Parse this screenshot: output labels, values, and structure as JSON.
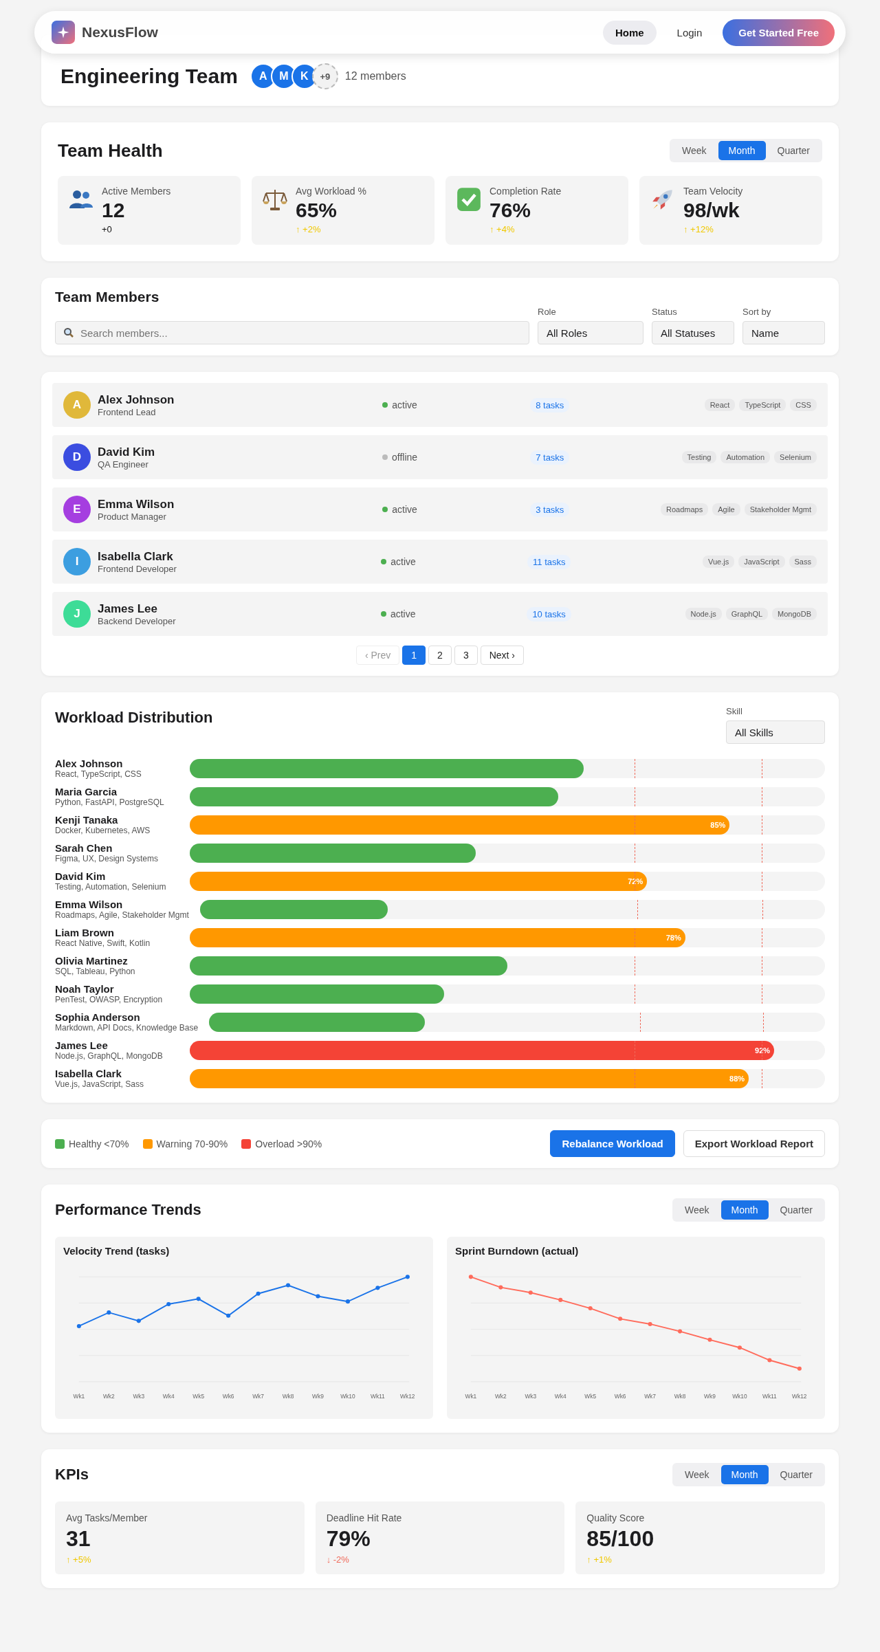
{
  "nav": {
    "brand": "NexusFlow",
    "links": [
      {
        "label": "Home",
        "selected": true
      },
      {
        "label": "Login",
        "selected": false
      }
    ],
    "cta": "Get Started Free"
  },
  "header": {
    "title": "Engineering Team",
    "avatars": [
      {
        "initial": "A",
        "color": "#1a73e8"
      },
      {
        "initial": "M",
        "color": "#1a73e8"
      },
      {
        "initial": "K",
        "color": "#1a73e8"
      }
    ],
    "more": "+9",
    "members": "12 members"
  },
  "team_health": {
    "title": "Team Health",
    "periods": [
      {
        "label": "Week",
        "selected": false
      },
      {
        "label": "Month",
        "selected": true
      },
      {
        "label": "Quarter",
        "selected": false
      }
    ],
    "stats": [
      {
        "kind": "people",
        "label": "Active Members",
        "value": "12",
        "change": "+0",
        "color": "#111111"
      },
      {
        "kind": "scale",
        "label": "Avg Workload %",
        "value": "65%",
        "change": "↑ +2%",
        "color": "#f0c800"
      },
      {
        "kind": "check",
        "label": "Completion Rate",
        "value": "76%",
        "change": "↑ +4%",
        "color": "#f0c800"
      },
      {
        "kind": "rocket",
        "label": "Team Velocity",
        "value": "98/wk",
        "change": "↑ +12%",
        "color": "#f0c800"
      }
    ]
  },
  "members_filter": {
    "title": "Team Members",
    "search": {
      "placeholder": "Search members..."
    },
    "filters": [
      {
        "label": "Role",
        "value": "All Roles"
      },
      {
        "label": "Status",
        "value": "All Statuses"
      },
      {
        "label": "Sort by",
        "value": "Name"
      }
    ]
  },
  "members": [
    {
      "initial": "A",
      "color": "#e0b83a",
      "name": "Alex Johnson",
      "role": "Frontend Lead",
      "status": "active",
      "online": true,
      "tasks": "8 tasks",
      "skills": [
        "React",
        "TypeScript",
        "CSS"
      ]
    },
    {
      "initial": "D",
      "color": "#3b4de0",
      "name": "David Kim",
      "role": "QA Engineer",
      "status": "offline",
      "online": false,
      "tasks": "7 tasks",
      "skills": [
        "Testing",
        "Automation",
        "Selenium"
      ]
    },
    {
      "initial": "E",
      "color": "#a53ee0",
      "name": "Emma Wilson",
      "role": "Product Manager",
      "status": "active",
      "online": true,
      "tasks": "3 tasks",
      "skills": [
        "Roadmaps",
        "Agile",
        "Stakeholder Mgmt"
      ]
    },
    {
      "initial": "I",
      "color": "#3c9ee0",
      "name": "Isabella Clark",
      "role": "Frontend Developer",
      "status": "active",
      "online": true,
      "tasks": "11 tasks",
      "skills": [
        "Vue.js",
        "JavaScript",
        "Sass"
      ]
    },
    {
      "initial": "J",
      "color": "#3ddc97",
      "name": "James Lee",
      "role": "Backend Developer",
      "status": "active",
      "online": true,
      "tasks": "10 tasks",
      "skills": [
        "Node.js",
        "GraphQL",
        "MongoDB"
      ]
    }
  ],
  "pagination": [
    {
      "label": "‹ Prev",
      "selected": false,
      "disabled": true
    },
    {
      "label": "1",
      "selected": true,
      "disabled": false
    },
    {
      "label": "2",
      "selected": false,
      "disabled": false
    },
    {
      "label": "3",
      "selected": false,
      "disabled": false
    },
    {
      "label": "Next ›",
      "selected": false,
      "disabled": false
    }
  ],
  "workload": {
    "title": "Workload Distribution",
    "filter": {
      "label": "Skill",
      "value": "All Skills"
    },
    "rows": [
      {
        "name": "Alex Johnson",
        "skills": "React, TypeScript, CSS",
        "level": 0.62
      },
      {
        "name": "Maria Garcia",
        "skills": "Python, FastAPI, PostgreSQL",
        "level": 0.58
      },
      {
        "name": "Kenji Tanaka",
        "skills": "Docker, Kubernetes, AWS",
        "level": 0.85,
        "label": "85%"
      },
      {
        "name": "Sarah Chen",
        "skills": "Figma, UX, Design Systems",
        "level": 0.45
      },
      {
        "name": "David Kim",
        "skills": "Testing, Automation, Selenium",
        "level": 0.72,
        "label": "72%"
      },
      {
        "name": "Emma Wilson",
        "skills": "Roadmaps, Agile, Stakeholder Mgmt",
        "level": 0.3
      },
      {
        "name": "Liam Brown",
        "skills": "React Native, Swift, Kotlin",
        "level": 0.78,
        "label": "78%"
      },
      {
        "name": "Olivia Martinez",
        "skills": "SQL, Tableau, Python",
        "level": 0.5
      },
      {
        "name": "Noah Taylor",
        "skills": "PenTest, OWASP, Encryption",
        "level": 0.4
      },
      {
        "name": "Sophia Anderson",
        "skills": "Markdown, API Docs, Knowledge Base",
        "level": 0.35
      },
      {
        "name": "James Lee",
        "skills": "Node.js, GraphQL, MongoDB",
        "level": 0.92,
        "label": "92%"
      },
      {
        "name": "Isabella Clark",
        "skills": "Vue.js, JavaScript, Sass",
        "level": 0.88,
        "label": "88%"
      }
    ]
  },
  "legend": {
    "items": [
      {
        "label": "Healthy <70%",
        "color": "#4caf50"
      },
      {
        "label": "Warning 70-90%",
        "color": "#ff9800"
      },
      {
        "label": "Overload >90%",
        "color": "#f44336"
      }
    ],
    "actions": [
      {
        "label": "Rebalance Workload",
        "kind": "primary"
      },
      {
        "label": "Export Workload Report",
        "kind": "secondary"
      }
    ]
  },
  "performance": {
    "title": "Performance Trends",
    "periods": [
      {
        "label": "Week",
        "selected": false
      },
      {
        "label": "Month",
        "selected": true
      },
      {
        "label": "Quarter",
        "selected": false
      }
    ],
    "charts": [
      {
        "kind": "velocity",
        "title": "Velocity Trend (tasks)",
        "color": "#1a73e8",
        "x_labels": [
          "Wk1",
          "Wk2",
          "Wk3",
          "Wk4",
          "Wk5",
          "Wk6",
          "Wk7",
          "Wk8",
          "Wk9",
          "Wk10",
          "Wk11",
          "Wk12"
        ]
      },
      {
        "kind": "burndown",
        "title": "Sprint Burndown (actual)",
        "color": "#ff6b5b",
        "x_labels": [
          "Wk1",
          "Wk2",
          "Wk3",
          "Wk4",
          "Wk5",
          "Wk6",
          "Wk7",
          "Wk8",
          "Wk9",
          "Wk10",
          "Wk11",
          "Wk12"
        ]
      }
    ]
  },
  "kpis": {
    "title": "KPIs",
    "periods": [
      {
        "label": "Week",
        "selected": false
      },
      {
        "label": "Month",
        "selected": true
      },
      {
        "label": "Quarter",
        "selected": false
      }
    ],
    "cards": [
      {
        "label": "Avg Tasks/Member",
        "value": "31",
        "change": "↑ +5%",
        "color": "#f0c800"
      },
      {
        "label": "Deadline Hit Rate",
        "value": "79%",
        "change": "↓ -2%",
        "color": "#f06a5a"
      },
      {
        "label": "Quality Score",
        "value": "85/100",
        "change": "↑ +1%",
        "color": "#f0c800"
      }
    ]
  }
}
